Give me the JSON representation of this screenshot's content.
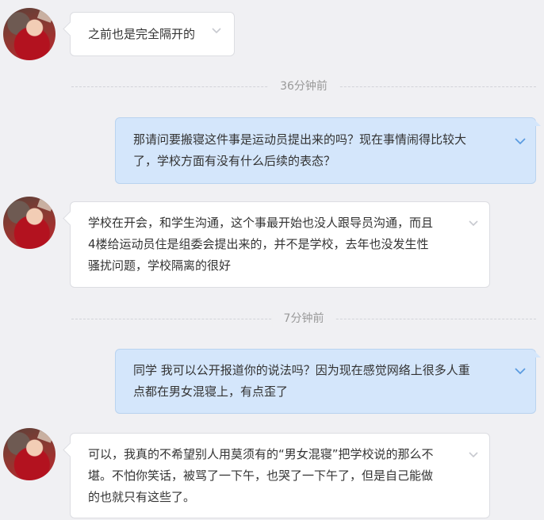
{
  "messages": [
    {
      "direction": "in",
      "text": "之前也是完全隔开的"
    },
    {
      "direction": "out",
      "text": "那请问要搬寝这件事是运动员提出来的吗？现在事情闹得比较大了，学校方面有没有什么后续的表态？"
    },
    {
      "direction": "in",
      "text": "学校在开会，和学生沟通，这个事最开始也没人跟导员沟通，而且4楼给运动员住是组委会提出来的，并不是学校，去年也没发生性骚扰问题，学校隔离的很好"
    },
    {
      "direction": "out",
      "text": "同学 我可以公开报道你的说法吗？因为现在感觉网络上很多人重点都在男女混寝上，有点歪了"
    },
    {
      "direction": "in",
      "text": "可以，我真的不希望别人用莫须有的“男女混寝”把学校说的那么不堪。不怕你笑话，被骂了一下午，也哭了一下午了，但是自己能做的也就只有这些了。"
    }
  ],
  "timestamps": [
    "36分钟前",
    "7分钟前"
  ],
  "lines": {
    "m1": [
      "之前也是完全隔开的"
    ],
    "m2": [
      "那请问要搬寝这件事是运动员提出来的吗？现在事情闹得比较大",
      "了，学校方面有没有什么后续的表态？"
    ],
    "m3": [
      "学校在开会，和学生沟通，这个事最开始也没人跟导员沟通，而且",
      "4楼给运动员住是组委会提出来的，并不是学校，去年也没发生性",
      "骚扰问题，学校隔离的很好"
    ],
    "m4": [
      "同学 我可以公开报道你的说法吗？因为现在感觉网络上很多人重",
      "点都在男女混寝上，有点歪了"
    ],
    "m5": [
      "可以，我真的不希望别人用莫须有的“男女混寝”把学校说的那么不",
      "堪。不怕你笑话，被骂了一下午，也哭了一下午了，但是自己能做",
      "的也就只有这些了。"
    ]
  },
  "icons": {
    "avatar": "contact-avatar",
    "menu": "chevron-down-icon"
  },
  "colors": {
    "background": "#f0f0f3",
    "incoming": "#ffffff",
    "outgoing": "#d4e6fb",
    "timestamp": "#999999"
  }
}
